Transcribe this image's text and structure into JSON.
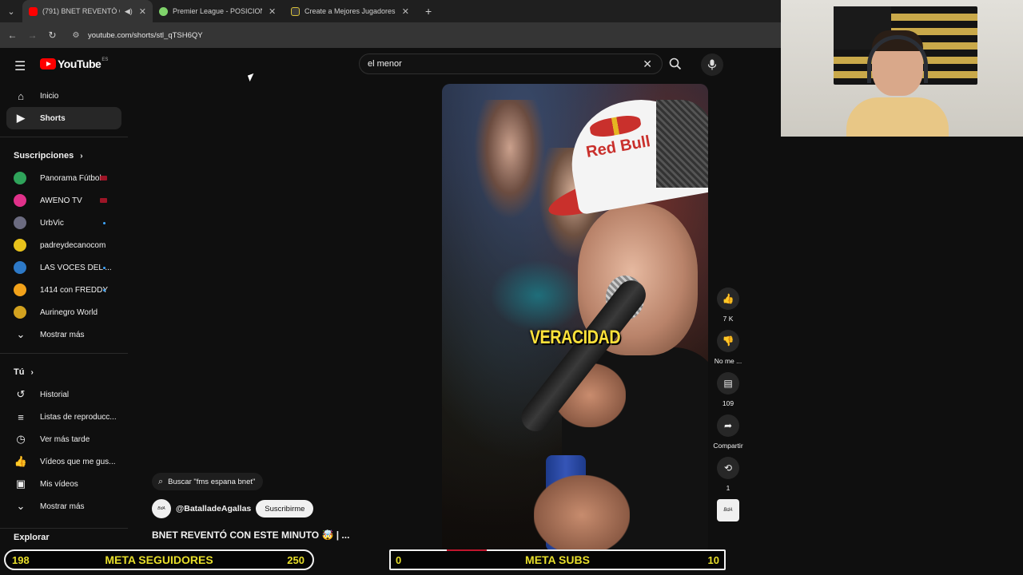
{
  "browser": {
    "tabs": [
      {
        "title": "(791) BNET REVENTÓ CON",
        "fav_color": "#ff0000"
      },
      {
        "title": "Premier League - POSICIONES",
        "fav_color": "#7fd36a"
      },
      {
        "title": "Create a Mejores Jugadores de",
        "fav_color": "#d9c13a"
      }
    ],
    "url": "youtube.com/shorts/stl_qTSH6QY"
  },
  "youtube": {
    "logo_text": "YouTube",
    "country_code": "ES",
    "search_value": "el menor",
    "nav": [
      {
        "label": "Inicio",
        "icon": "home-icon"
      },
      {
        "label": "Shorts",
        "icon": "shorts-icon"
      }
    ],
    "subscriptions_header": "Suscripciones",
    "subscriptions": [
      {
        "label": "Panorama Fútbol",
        "color": "#2fa35a",
        "status": "live"
      },
      {
        "label": "AWENO TV",
        "color": "#e0318a",
        "status": "live"
      },
      {
        "label": "UrbVic",
        "color": "#6b6b80",
        "status": "new"
      },
      {
        "label": "padreydecanocom",
        "color": "#e8c21b",
        "status": ""
      },
      {
        "label": "LAS VOCES DEL ...",
        "color": "#2d79c7",
        "status": "new"
      },
      {
        "label": "1414 con FREDDY",
        "color": "#f2a21a",
        "status": "new"
      },
      {
        "label": "Aurinegro World",
        "color": "#d3a21f",
        "status": ""
      }
    ],
    "show_more": "Mostrar más",
    "you_header": "Tú",
    "you_items": [
      {
        "label": "Historial",
        "icon": "history-icon"
      },
      {
        "label": "Listas de reproducc...",
        "icon": "playlist-icon"
      },
      {
        "label": "Ver más tarde",
        "icon": "clock-icon"
      },
      {
        "label": "Vídeos que me gus...",
        "icon": "like-icon"
      },
      {
        "label": "Mis vídeos",
        "icon": "video-icon"
      }
    ],
    "show_more_2": "Mostrar más",
    "explore_header": "Explorar",
    "short": {
      "caption": "VERACIDAD",
      "cap_text": "Red Bull",
      "search_suggestion": "Buscar \"fms espana bnet\"",
      "channel": "@BatalladeAgallas",
      "subscribe": "Suscribirme",
      "title": "BNET REVENTÓ CON ESTE MINUTO 🤯 | ...",
      "actions": {
        "likes": "7 K",
        "dislike": "No me ...",
        "comments": "109",
        "share": "Compartir",
        "remix": "1"
      }
    }
  },
  "overlays": {
    "followers": {
      "current": "198",
      "label": "META SEGUIDORES",
      "goal": "250"
    },
    "subs": {
      "current": "0",
      "label": "META SUBS",
      "goal": "10"
    }
  }
}
